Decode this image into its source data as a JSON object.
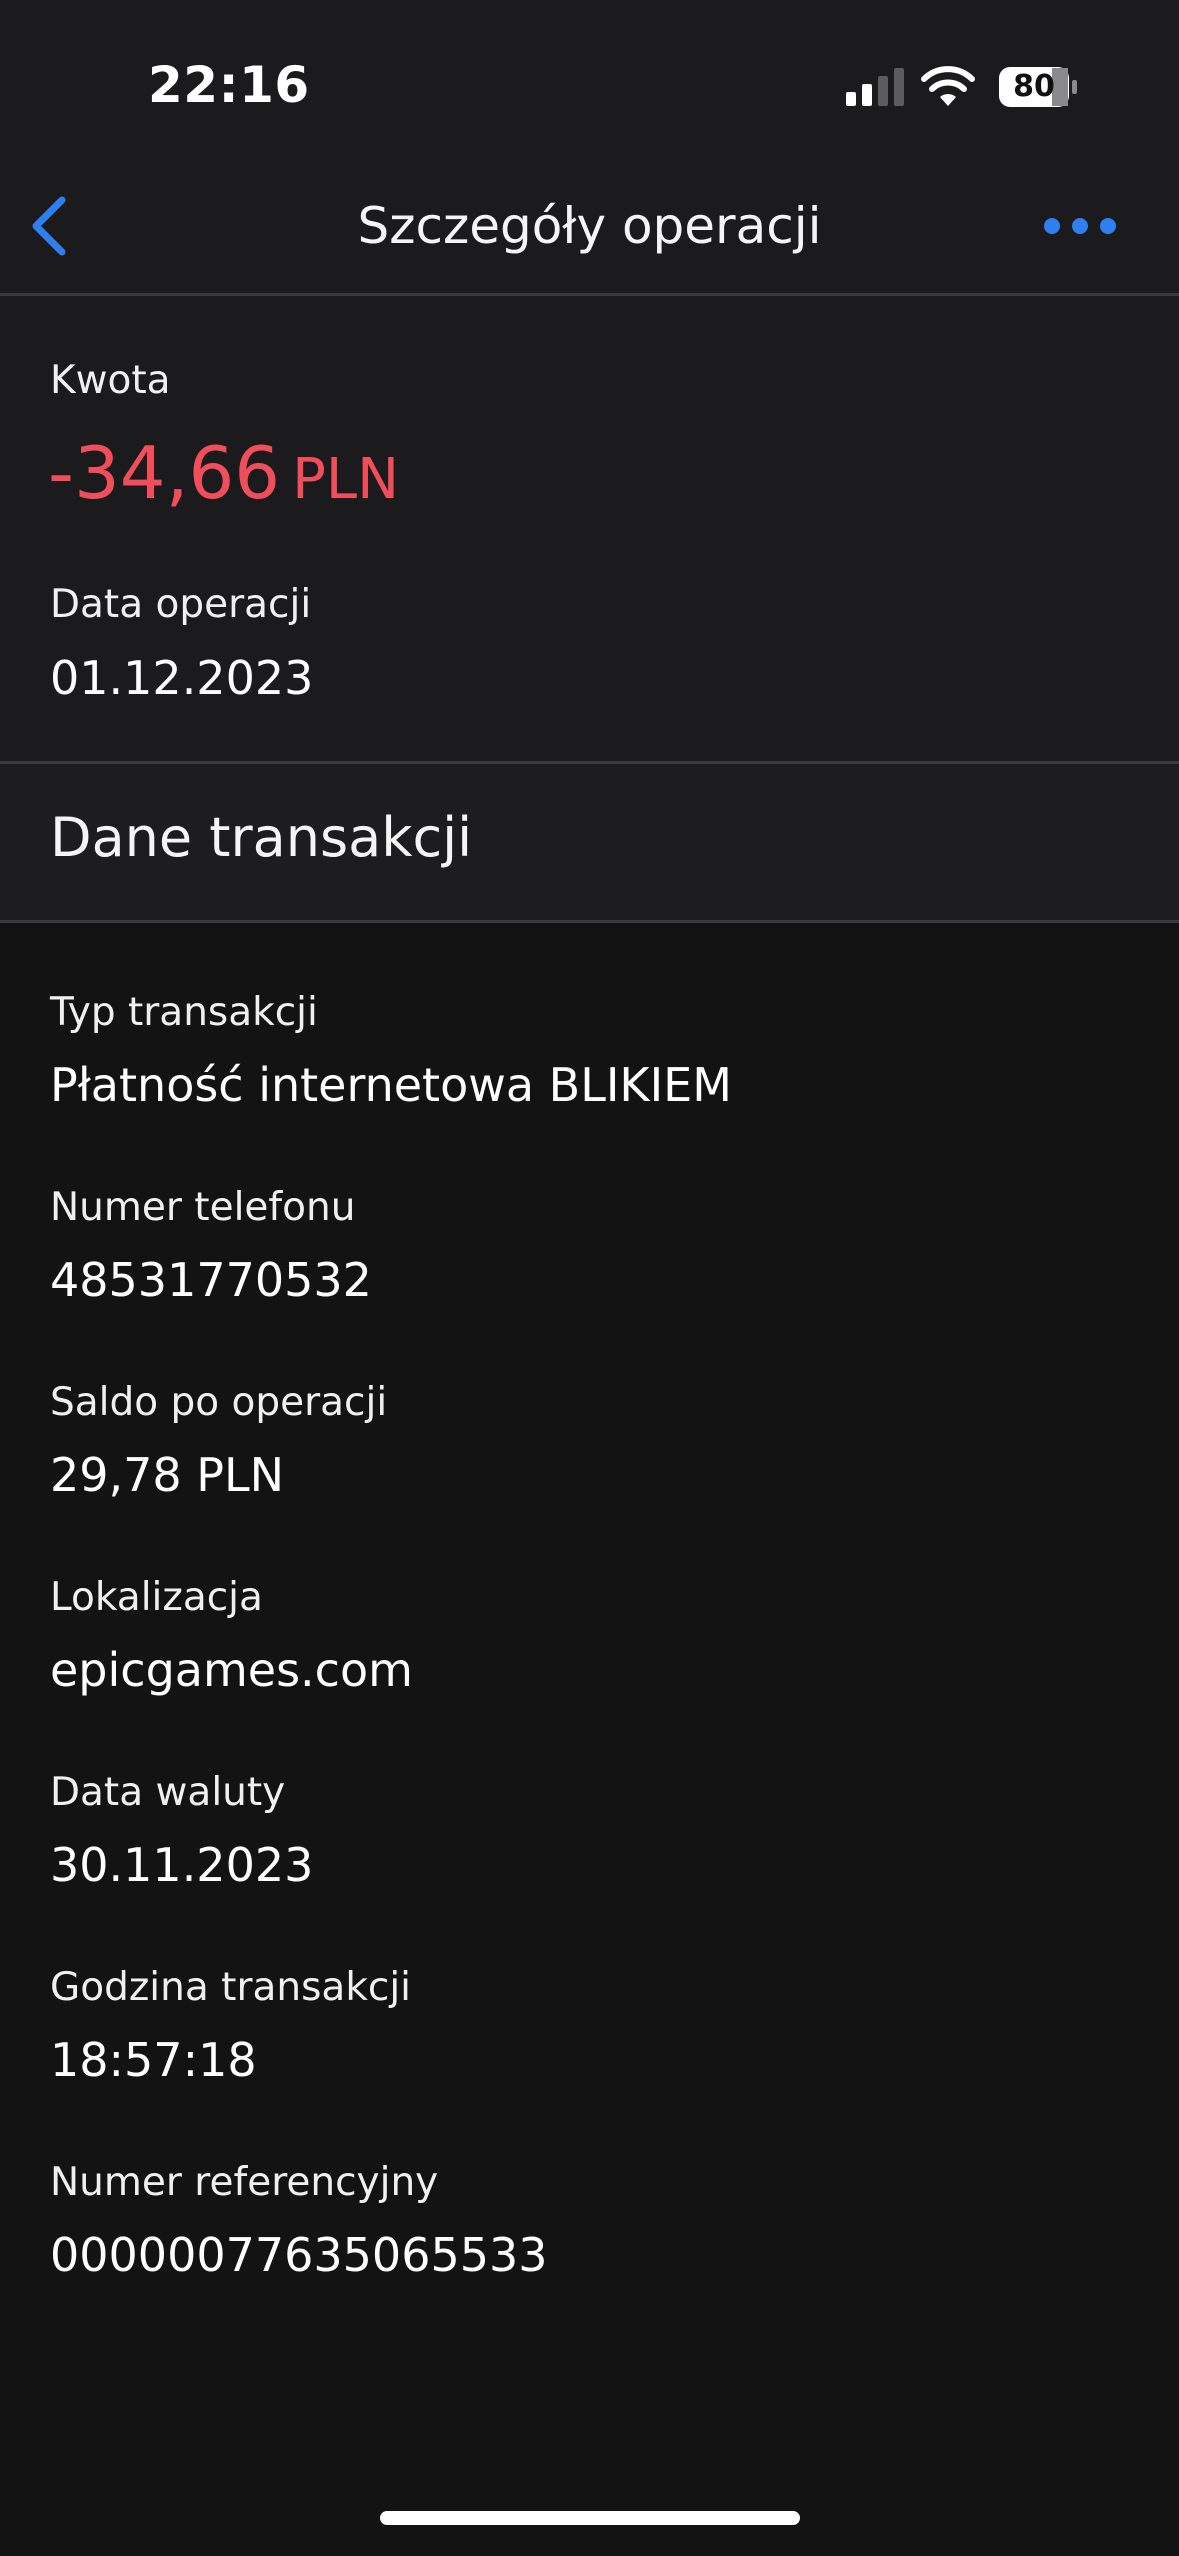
{
  "status_bar": {
    "time": "22:16",
    "battery_level": "80",
    "signal_icon": "cellular-signal-icon",
    "wifi_icon": "wifi-icon",
    "battery_icon": "battery-icon"
  },
  "nav": {
    "title": "Szczegóły operacji",
    "back_icon": "chevron-left-icon",
    "more_icon": "more-dots-icon"
  },
  "summary": {
    "amount_label": "Kwota",
    "amount_value": "-34,66",
    "amount_currency": "PLN",
    "date_label": "Data operacji",
    "date_value": "01.12.2023"
  },
  "section": {
    "title": "Dane transakcji"
  },
  "details": [
    {
      "label": "Typ transakcji",
      "value": "Płatność internetowa BLIKIEM"
    },
    {
      "label": "Numer telefonu",
      "value": "48531770532"
    },
    {
      "label": "Saldo po operacji",
      "value": "29,78 PLN"
    },
    {
      "label": "Lokalizacja",
      "value": "epicgames.com"
    },
    {
      "label": "Data waluty",
      "value": "30.11.2023"
    },
    {
      "label": "Godzina transakcji",
      "value": "18:57:18"
    },
    {
      "label": "Numer referencyjny",
      "value": "00000077635065533"
    }
  ],
  "colors": {
    "accent": "#2f7ff0",
    "negative_amount": "#f04e5a",
    "background": "#131313",
    "header_background": "#1b1b1d"
  }
}
